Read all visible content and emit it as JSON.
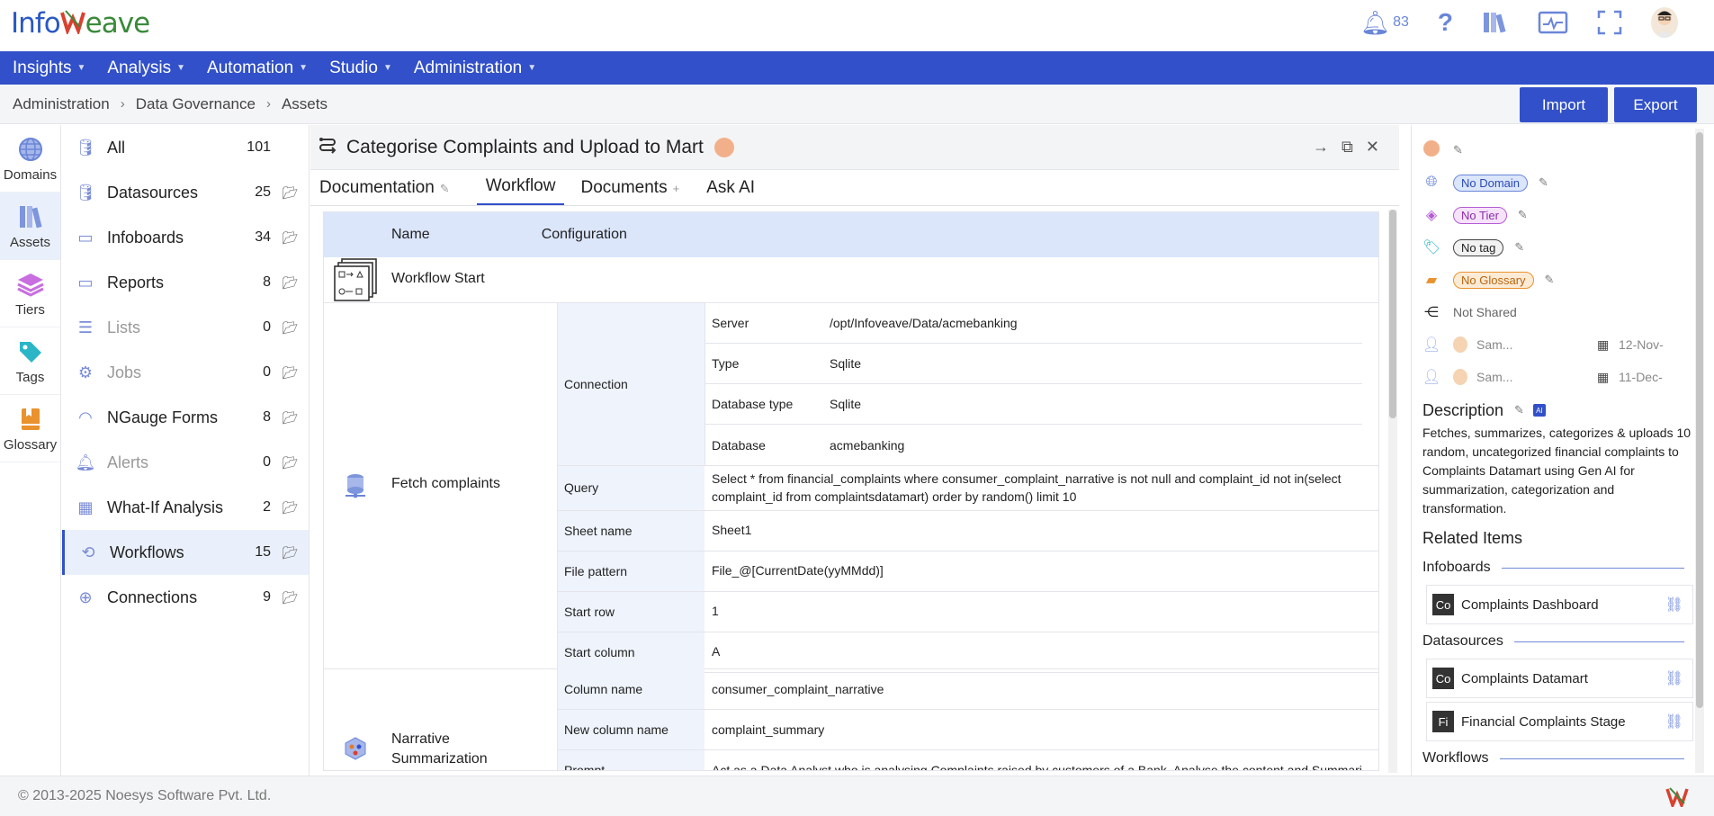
{
  "app": {
    "logo_part1": "Info",
    "logo_part2": "eave",
    "notifications_count": "83"
  },
  "nav": [
    "Insights",
    "Analysis",
    "Automation",
    "Studio",
    "Administration"
  ],
  "breadcrumb": [
    "Administration",
    "Data Governance",
    "Assets"
  ],
  "actions": {
    "import": "Import",
    "export": "Export"
  },
  "left_rail": [
    {
      "label": "Domains",
      "icon": "globe-icon"
    },
    {
      "label": "Assets",
      "icon": "books-icon"
    },
    {
      "label": "Tiers",
      "icon": "layers-icon"
    },
    {
      "label": "Tags",
      "icon": "tag-icon"
    },
    {
      "label": "Glossary",
      "icon": "glossary-icon"
    }
  ],
  "asset_types": [
    {
      "label": "All",
      "count": "101",
      "icon": "database-icon"
    },
    {
      "label": "Datasources",
      "count": "25",
      "icon": "database-icon"
    },
    {
      "label": "Infoboards",
      "count": "34",
      "icon": "infoboard-icon"
    },
    {
      "label": "Reports",
      "count": "8",
      "icon": "report-icon"
    },
    {
      "label": "Lists",
      "count": "0",
      "icon": "list-icon"
    },
    {
      "label": "Jobs",
      "count": "0",
      "icon": "gears-icon"
    },
    {
      "label": "NGauge Forms",
      "count": "8",
      "icon": "gauge-icon"
    },
    {
      "label": "Alerts",
      "count": "0",
      "icon": "bell-icon"
    },
    {
      "label": "What-If Analysis",
      "count": "2",
      "icon": "whatif-icon"
    },
    {
      "label": "Workflows",
      "count": "15",
      "icon": "workflow-icon"
    },
    {
      "label": "Connections",
      "count": "9",
      "icon": "connection-icon"
    }
  ],
  "asset": {
    "title": "Categorise Complaints and Upload to Mart"
  },
  "tabs": [
    "Documentation",
    "Workflow",
    "Documents",
    "Ask AI"
  ],
  "workflow": {
    "col_name": "Name",
    "col_config": "Configuration",
    "start": "Workflow Start",
    "fetch": {
      "name": "Fetch complaints",
      "connection_label": "Connection",
      "connection": [
        {
          "k": "Server",
          "v": "/opt/Infoveave/Data/acmebanking"
        },
        {
          "k": "Type",
          "v": "Sqlite"
        },
        {
          "k": "Database type",
          "v": "Sqlite"
        },
        {
          "k": "Database",
          "v": "acmebanking"
        }
      ],
      "rows": [
        {
          "k": "Query",
          "v": "Select * from financial_complaints where consumer_complaint_narrative is not null and complaint_id not in(select complaint_id from complaintsdatamart) order by random() limit 10"
        },
        {
          "k": "Sheet name",
          "v": "Sheet1"
        },
        {
          "k": "File pattern",
          "v": "File_@[CurrentDate(yyMMdd)]"
        },
        {
          "k": "Start row",
          "v": "1"
        },
        {
          "k": "Start column",
          "v": "A"
        }
      ]
    },
    "narrative": {
      "name": "Narrative Summarization",
      "rows": [
        {
          "k": "Column name",
          "v": "consumer_complaint_narrative"
        },
        {
          "k": "New column name",
          "v": "complaint_summary"
        },
        {
          "k": "Prompt",
          "v": "Act as a Data Analyst who is analysing Complaints raised by customers of a Bank. Analyse the content and Summari"
        }
      ]
    }
  },
  "details": {
    "domain": "No Domain",
    "tier": "No Tier",
    "tag": "No tag",
    "glossary": "No Glossary",
    "shared": "Not Shared",
    "created_by": "Sam...",
    "created_on": "12-Nov-",
    "modified_by": "Sam...",
    "modified_on": "11-Dec-",
    "description_title": "Description",
    "description": "Fetches, summarizes, categorizes & uploads 10 random, uncategorized financial complaints to Complaints Datamart using Gen AI for summarization, categorization and transformation.",
    "related_title": "Related Items",
    "infoboards_title": "Infoboards",
    "infoboards": [
      {
        "abbr": "Co",
        "name": "Complaints Dashboard"
      }
    ],
    "datasources_title": "Datasources",
    "datasources": [
      {
        "abbr": "Co",
        "name": "Complaints Datamart"
      },
      {
        "abbr": "Fi",
        "name": "Financial Complaints Stage"
      }
    ],
    "workflows_title": "Workflows"
  },
  "footer": "© 2013-2025 Noesys Software Pvt. Ltd."
}
